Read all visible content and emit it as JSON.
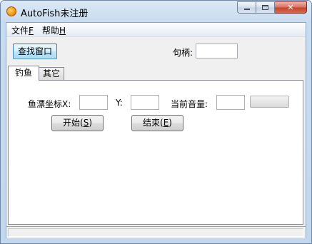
{
  "window": {
    "title": "AutoFish未注册"
  },
  "caption_buttons": {
    "minimize": "minimize-icon",
    "maximize": "maximize-icon",
    "close": "close-icon"
  },
  "menu": {
    "items": [
      {
        "label": "文件",
        "mnemonic": "F"
      },
      {
        "label": "帮助",
        "mnemonic": "H"
      }
    ]
  },
  "toolbar": {
    "find_window_label": "查找窗口",
    "handle_label": "句柄:",
    "handle_value": ""
  },
  "tabs": [
    {
      "label": "钓鱼",
      "active": true
    },
    {
      "label": "其它",
      "active": false
    }
  ],
  "fishing": {
    "float_coord_label": "鱼漂坐标X:",
    "x_value": "",
    "y_label": "Y:",
    "y_value": "",
    "volume_label": "当前音量:",
    "volume_value": "",
    "volume_level_percent": 0,
    "start_label": "开始(",
    "start_key": "S",
    "start_close": ")",
    "stop_label": "结束(",
    "stop_key": "E",
    "stop_close": ")"
  },
  "status": {
    "text": ""
  }
}
